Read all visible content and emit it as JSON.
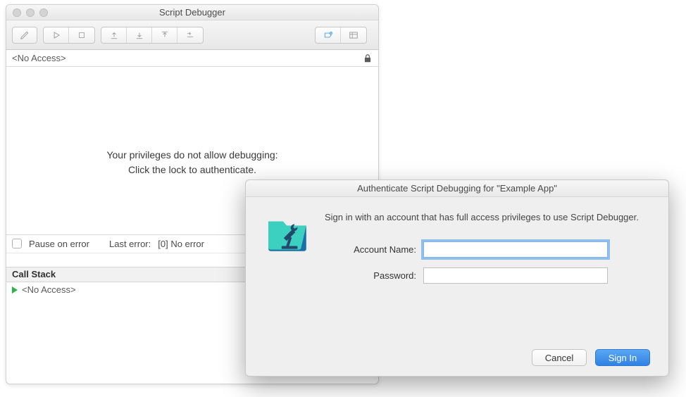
{
  "window": {
    "title": "Script Debugger",
    "status": "<No Access>",
    "message_line1": "Your privileges do not allow debugging:",
    "message_line2": "Click the lock to authenticate.",
    "pause_label": "Pause on error",
    "last_error_label": "Last error:",
    "last_error_value": "[0] No error",
    "callstack_header": "Call Stack",
    "callstack_item": "<No Access>"
  },
  "dialog": {
    "title": "Authenticate Script Debugging for \"Example App\"",
    "message": "Sign in with an account that has full access privileges to use Script Debugger.",
    "account_label": "Account Name:",
    "password_label": "Password:",
    "account_value": "",
    "password_value": "",
    "cancel": "Cancel",
    "signin": "Sign In"
  }
}
